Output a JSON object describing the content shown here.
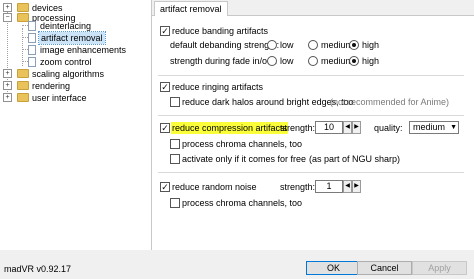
{
  "tree": {
    "items": [
      {
        "label": "devices",
        "expander": "+"
      },
      {
        "label": "processing",
        "expander": "−"
      },
      {
        "label": "deinterlacing"
      },
      {
        "label": "artifact removal"
      },
      {
        "label": "image enhancements"
      },
      {
        "label": "zoom control"
      },
      {
        "label": "scaling algorithms",
        "expander": "+"
      },
      {
        "label": "rendering",
        "expander": "+"
      },
      {
        "label": "user interface",
        "expander": "+"
      }
    ]
  },
  "tab": {
    "label": "artifact removal"
  },
  "banding": {
    "checkbox_label": "reduce banding artifacts",
    "checked": true,
    "default_strength_label": "default debanding strength:",
    "fade_strength_label": "strength during fade in/out:",
    "options": [
      "low",
      "medium",
      "high"
    ],
    "default_selected": "high",
    "fade_selected": "high"
  },
  "ringing": {
    "checkbox_label": "reduce ringing artifacts",
    "checked": true,
    "halos_label": "reduce dark halos around bright edges, too",
    "halos_checked": false,
    "halos_note": "(not recommended for Anime)"
  },
  "compression": {
    "checkbox_label": "reduce compression artifacts",
    "checked": true,
    "strength_label": "strength:",
    "strength_value": "10",
    "quality_label": "quality:",
    "quality_value": "medium",
    "chroma_label": "process chroma channels, too",
    "chroma_checked": false,
    "free_label": "activate only if it comes for free",
    "free_note": "(as part of NGU sharp)",
    "free_checked": false
  },
  "noise": {
    "checkbox_label": "reduce random noise",
    "checked": true,
    "strength_label": "strength:",
    "strength_value": "1",
    "chroma_label": "process chroma channels, too",
    "chroma_checked": false
  },
  "footer": {
    "version": "madVR v0.92.17",
    "ok": "OK",
    "cancel": "Cancel",
    "apply": "Apply"
  },
  "colors": {
    "highlight": "#fbff3a",
    "selection": "#cce4f7",
    "folder": "#e9c25a"
  }
}
